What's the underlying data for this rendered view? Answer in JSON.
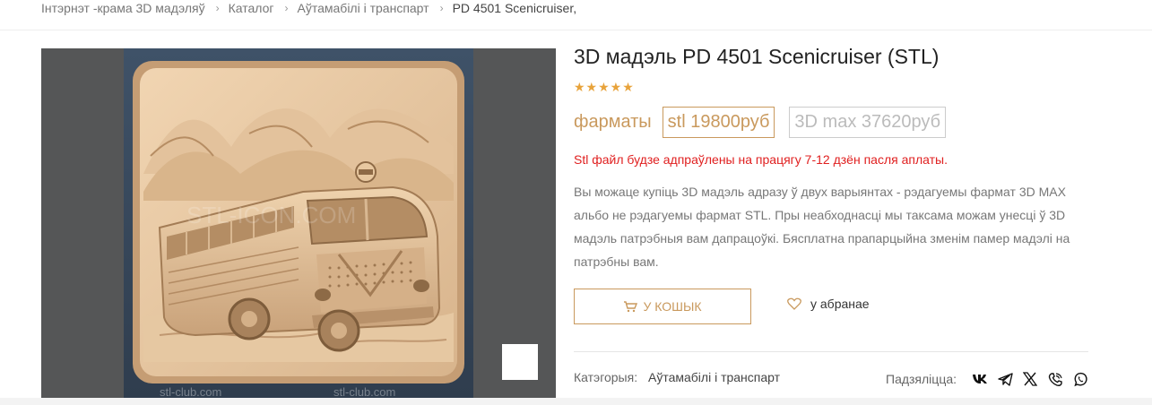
{
  "breadcrumb": {
    "home": "Інтэрнэт -крама 3D мадэляў",
    "catalog": "Каталог",
    "category": "Аўтамабілі і транспарт",
    "current": "PD 4501 Scenicruiser,"
  },
  "product": {
    "title": "3D мадэль PD 4501 Scenicruiser (STL)",
    "rating_stars": 5,
    "stars": "★★★★★",
    "formats_label": "фарматы",
    "format_stl": "stl 19800руб",
    "format_3dmax": "3D max 37620руб",
    "notice": "Stl файл будзе адпраўлены на працягу 7-12 дзён пасля аплаты.",
    "description": "Вы можаце купіць 3D мадэль адразу ў двух варыянтах - рэдагуемы фармат 3D MAX альбо не рэдагуемы фармат STL. Пры неабходнасці мы таксама можам унесці ў 3D мадэль патрэбныя вам дапрацоўкі. Бясплатна прапарцыйна зменім памер мадэлі на патрэбны вам.",
    "cart_label": "У КОШЫК",
    "favorite_label": "у абранае",
    "category_label": "Катэгорыя:",
    "category_value": "Аўтамабілі і транспарт",
    "share_label": "Падзяліцца:"
  },
  "image": {
    "watermark_center": "STL-ICON.COM",
    "watermark_left": "stl-club.com",
    "watermark_right": "stl-club.com"
  },
  "colors": {
    "accent": "#c9995d",
    "notice": "#e02020",
    "star": "#e8a33b"
  },
  "icons": [
    "chevron-right-icon",
    "expand-icon",
    "cart-icon",
    "heart-icon",
    "vk-icon",
    "telegram-icon",
    "x-icon",
    "viber-icon",
    "whatsapp-icon"
  ]
}
